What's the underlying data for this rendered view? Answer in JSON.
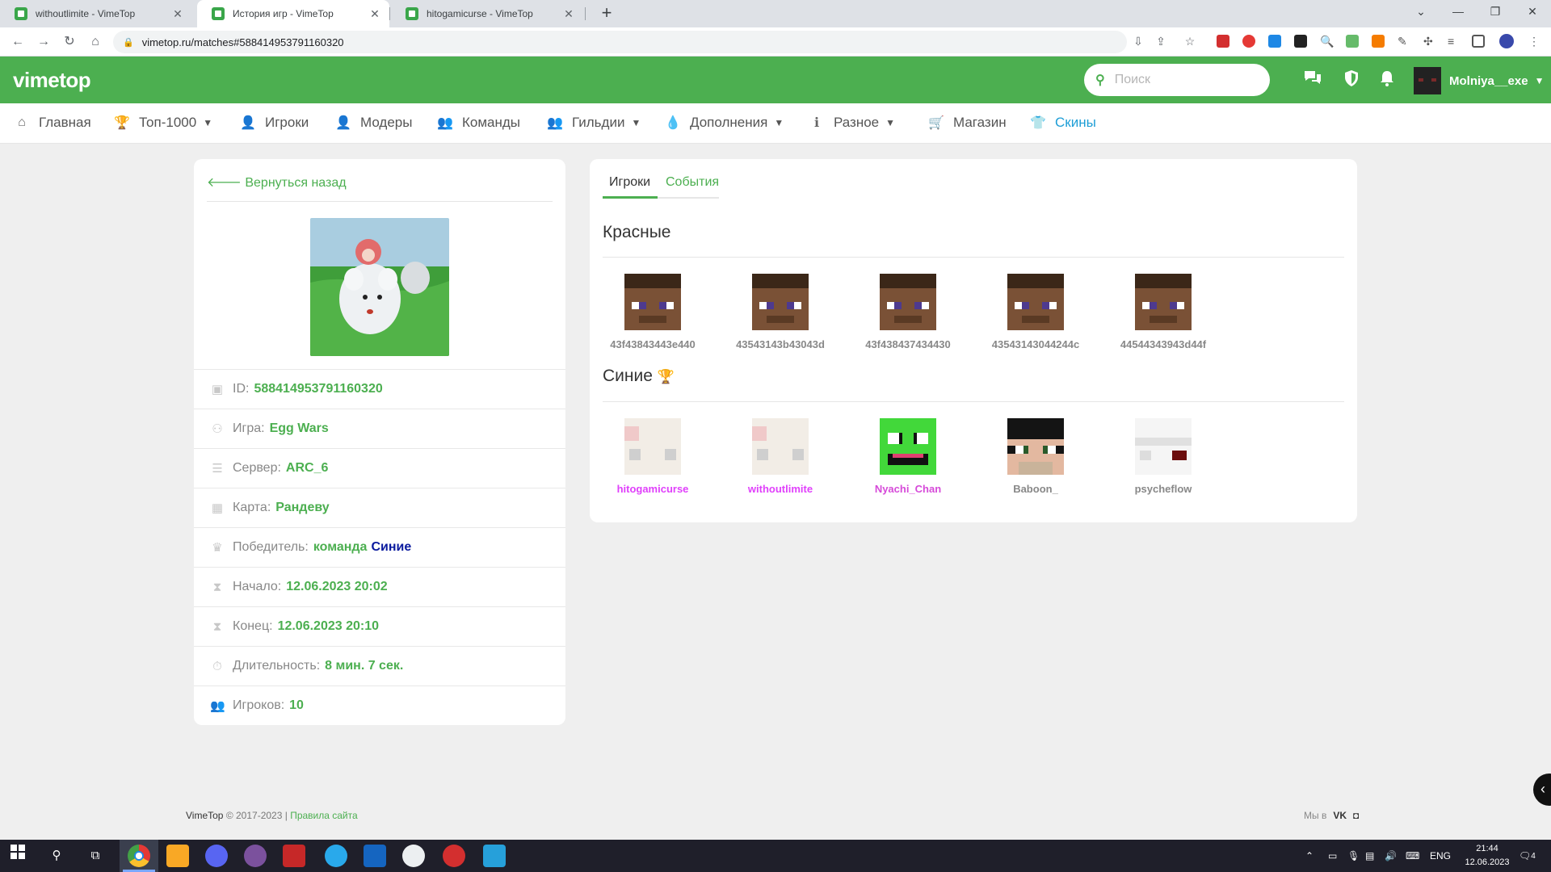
{
  "browser": {
    "tabs": [
      {
        "title": "withoutlimite - VimeTop",
        "active": false
      },
      {
        "title": "История игр - VimeTop",
        "active": true
      },
      {
        "title": "hitogamicurse - VimeTop",
        "active": false
      }
    ],
    "url": "vimetop.ru/matches#588414953791160320"
  },
  "header": {
    "logo": "vimetop",
    "search_placeholder": "Поиск",
    "username": "Molniya__exe"
  },
  "nav": {
    "items": [
      {
        "label": "Главная",
        "icon": "home-icon",
        "dropdown": false
      },
      {
        "label": "Топ-1000",
        "icon": "trophy-icon",
        "dropdown": true
      },
      {
        "label": "Игроки",
        "icon": "user-plus-icon",
        "dropdown": false
      },
      {
        "label": "Модеры",
        "icon": "user-shield-icon",
        "dropdown": false
      },
      {
        "label": "Команды",
        "icon": "users-icon",
        "dropdown": false
      },
      {
        "label": "Гильдии",
        "icon": "user-friends-icon",
        "dropdown": true
      },
      {
        "label": "Дополнения",
        "icon": "drop-icon",
        "dropdown": true
      },
      {
        "label": "Разное",
        "icon": "info-icon",
        "dropdown": true
      },
      {
        "label": "Магазин",
        "icon": "cart-icon",
        "dropdown": false
      },
      {
        "label": "Скины",
        "icon": "skin-icon",
        "dropdown": false,
        "active": true
      }
    ]
  },
  "match": {
    "back_label": "Вернуться назад",
    "rows": {
      "id": {
        "label": "ID:",
        "value": "588414953791160320"
      },
      "game": {
        "label": "Игра:",
        "value": "Egg Wars"
      },
      "server": {
        "label": "Сервер:",
        "value": "ARC_6"
      },
      "map": {
        "label": "Карта:",
        "value": "Рандеву"
      },
      "winner": {
        "label": "Победитель:",
        "value": "команда",
        "team": "Синие"
      },
      "start": {
        "label": "Начало:",
        "value": "12.06.2023 20:02"
      },
      "end": {
        "label": "Конец:",
        "value": "12.06.2023 20:10"
      },
      "duration": {
        "label": "Длительность:",
        "value": "8 мин. 7 сек."
      },
      "players": {
        "label": "Игроков:",
        "value": "10"
      }
    }
  },
  "panel": {
    "tabs": [
      "Игроки",
      "События"
    ],
    "teams": {
      "red": {
        "title": "Красные",
        "players": [
          "43f43843443e440",
          "43543143b43043d",
          "43f438437434430",
          "43543143044244c",
          "44544343943d44f"
        ]
      },
      "blue": {
        "title": "Синие",
        "trophy": "🏆",
        "players": [
          "hitogamicurse",
          "withoutlimite",
          "Nyachi_Chan",
          "Baboon_",
          "psycheflow"
        ]
      }
    }
  },
  "footer": {
    "brand": "VimeTop",
    "copyright": "© 2017-2023 |",
    "rules_link": "Правила сайта",
    "social_label": "Мы в",
    "social_vk": "VK"
  },
  "taskbar": {
    "lang": "ENG",
    "time": "21:44",
    "date": "12.06.2023",
    "notifications": "4"
  }
}
